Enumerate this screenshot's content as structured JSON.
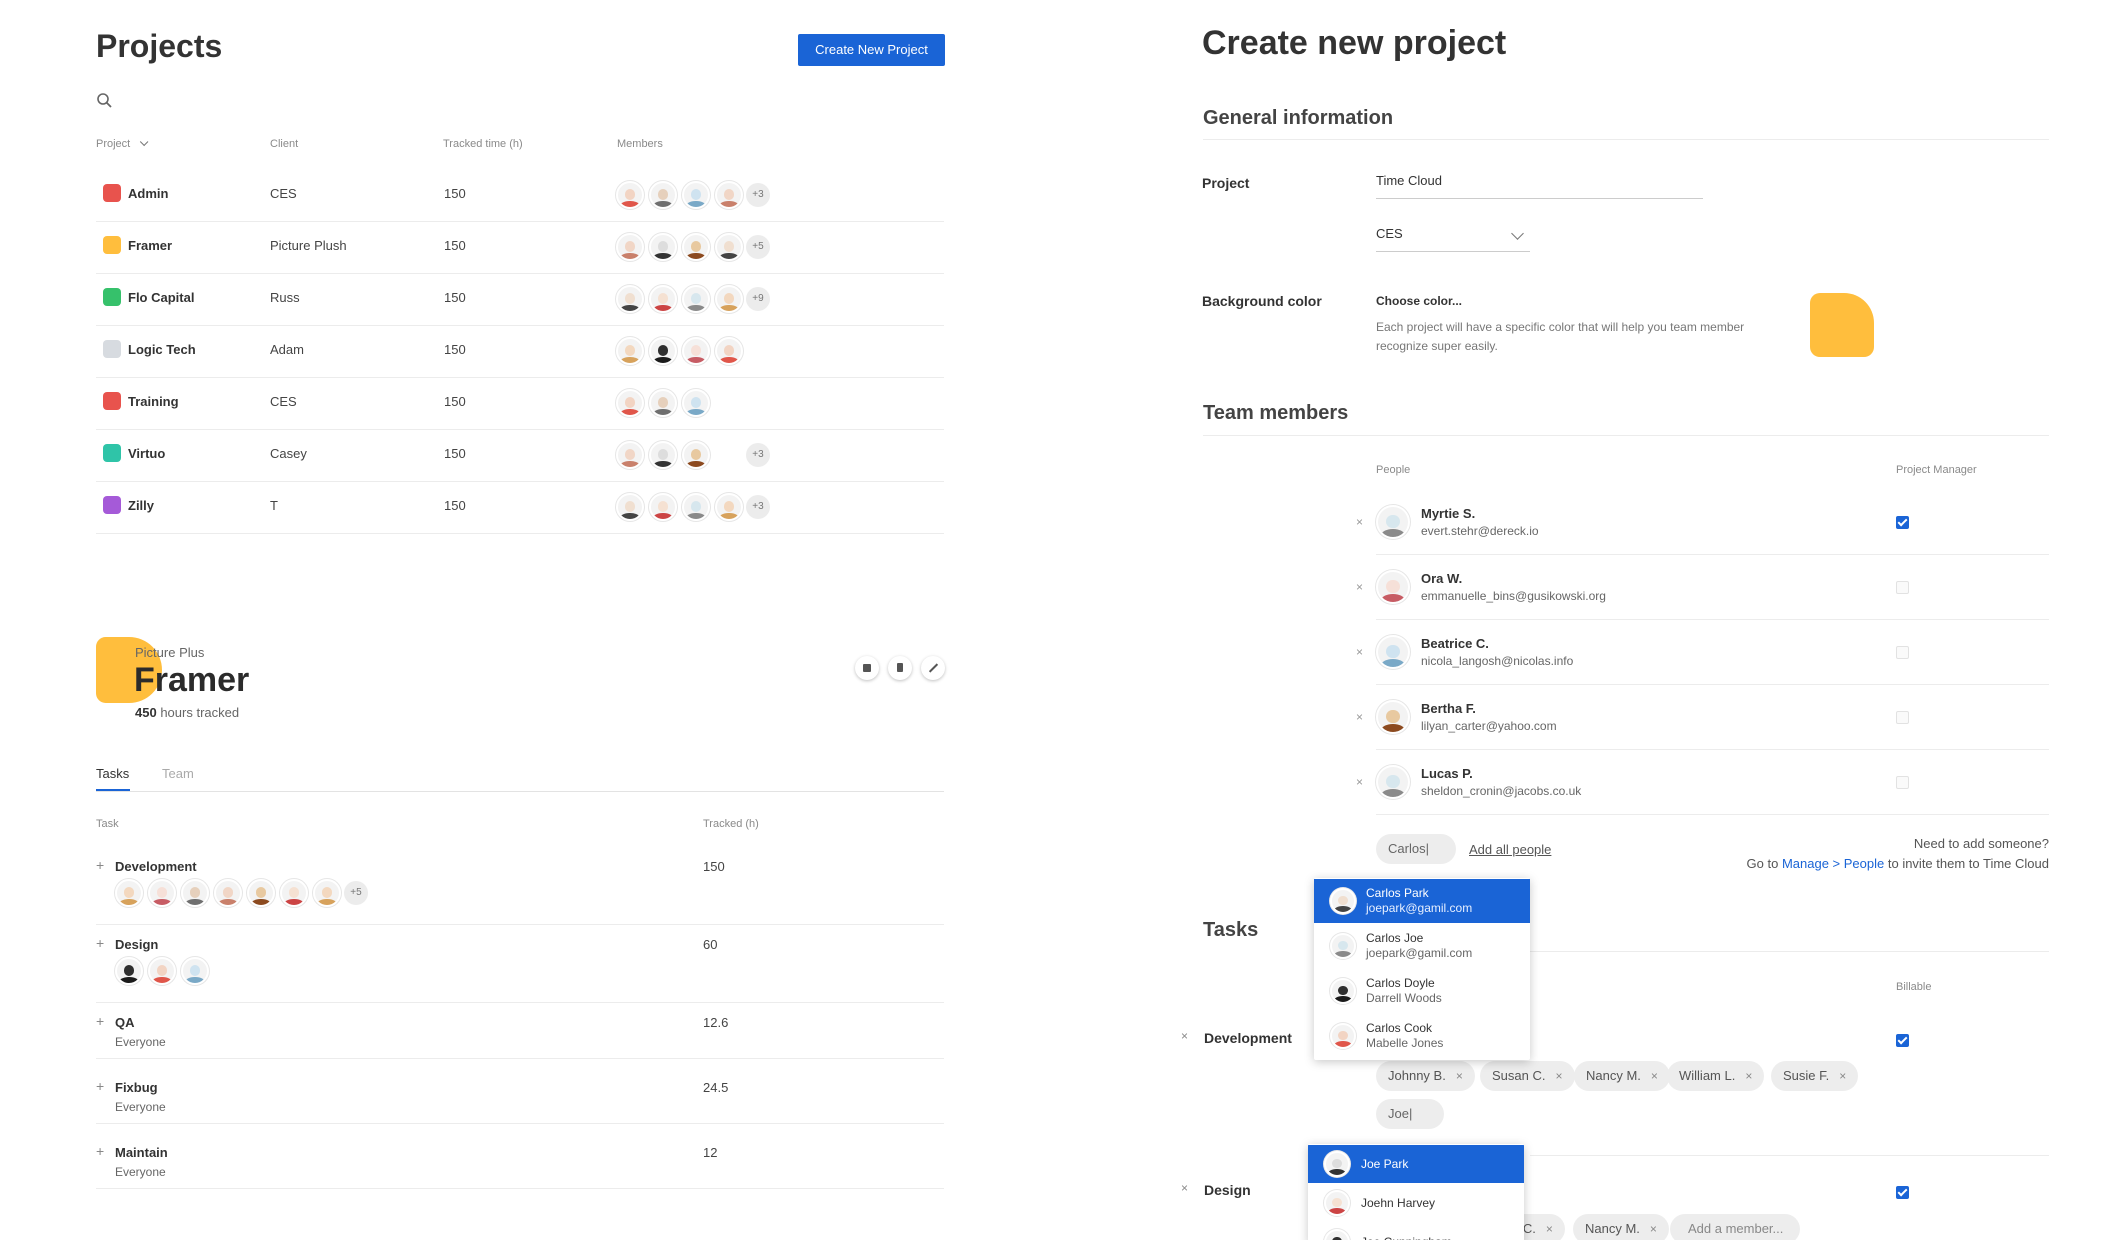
{
  "colors": {
    "accent": "#1a64d6",
    "yellow": "#ffbe3d",
    "red": "#e8534d",
    "green": "#36c16b",
    "grey": "#d7dbe0",
    "teal": "#2fc4a8",
    "purple": "#a55ad8"
  },
  "projects": {
    "title": "Projects",
    "create_button": "Create New Project",
    "search_icon": "search-icon",
    "columns": [
      "Project",
      "Client",
      "Tracked time (h)",
      "Members"
    ],
    "rows": [
      {
        "name": "Admin",
        "client": "CES",
        "tracked": "150",
        "color": "#e8534d",
        "more": "+3"
      },
      {
        "name": "Framer",
        "client": "Picture Plush",
        "tracked": "150",
        "color": "#ffbe3d",
        "more": "+5"
      },
      {
        "name": "Flo Capital",
        "client": "Russ",
        "tracked": "150",
        "color": "#36c16b",
        "more": "+9"
      },
      {
        "name": "Logic Tech",
        "client": "Adam",
        "tracked": "150",
        "color": "#d7dbe0",
        "more": ""
      },
      {
        "name": "Training",
        "client": "CES",
        "tracked": "150",
        "color": "#e8534d",
        "more": ""
      },
      {
        "name": "Virtuo",
        "client": "Casey",
        "tracked": "150",
        "color": "#2fc4a8",
        "more": "+3"
      },
      {
        "name": "Zilly",
        "client": "T",
        "tracked": "150",
        "color": "#a55ad8",
        "more": "+3"
      }
    ]
  },
  "detail": {
    "client": "Picture Plus",
    "name": "Framer",
    "hours_value": "450",
    "hours_label": "hours tracked",
    "tabs": [
      "Tasks",
      "Team"
    ],
    "columns": [
      "Task",
      "Tracked (h)"
    ],
    "tasks": [
      {
        "name": "Development",
        "tracked": "150",
        "sub": "",
        "more": "+5"
      },
      {
        "name": "Design",
        "tracked": "60",
        "sub": "",
        "more": ""
      },
      {
        "name": "QA",
        "tracked": "12.6",
        "sub": "Everyone",
        "more": ""
      },
      {
        "name": "Fixbug",
        "tracked": "24.5",
        "sub": "Everyone",
        "more": ""
      },
      {
        "name": "Maintain",
        "tracked": "12",
        "sub": "Everyone",
        "more": ""
      }
    ]
  },
  "create": {
    "title": "Create new project",
    "general_heading": "General information",
    "project_label": "Project",
    "project_value": "Time Cloud",
    "client_value": "CES",
    "bg_label": "Background color",
    "choose_color": "Choose color...",
    "color_help": "Each project will have a specific color that will help you team member recognize super easily.",
    "team_heading": "Team members",
    "people_col": "People",
    "pm_col": "Project Manager",
    "members": [
      {
        "name": "Myrtie S.",
        "email": "evert.stehr@dereck.io",
        "pm": true
      },
      {
        "name": "Ora W.",
        "email": "emmanuelle_bins@gusikowski.org",
        "pm": false
      },
      {
        "name": "Beatrice C.",
        "email": "nicola_langosh@nicolas.info",
        "pm": false
      },
      {
        "name": "Bertha F.",
        "email": "lilyan_carter@yahoo.com",
        "pm": false
      },
      {
        "name": "Lucas P.",
        "email": "sheldon_cronin@jacobs.co.uk",
        "pm": false
      }
    ],
    "member_search_value": "Carlos|",
    "add_all": "Add all people",
    "need_add": "Need to add someone?",
    "go_to": "Go to",
    "manage_link": "Manage > People",
    "invite_text": "to invite them to Time Cloud",
    "people_dropdown": [
      {
        "name": "Carlos Park",
        "sub": "joepark@gamil.com"
      },
      {
        "name": "Carlos Joe",
        "sub": "joepark@gamil.com"
      },
      {
        "name": "Carlos Doyle",
        "sub": "Darrell Woods"
      },
      {
        "name": "Carlos Cook",
        "sub": "Mabelle Jones"
      }
    ],
    "tasks_heading": "Tasks",
    "billable_col": "Billable",
    "task_rows": [
      {
        "name": "Development"
      },
      {
        "name": "Design"
      }
    ],
    "dev_chips": [
      "Johnny B.",
      "Susan C.",
      "Nancy M.",
      "William L.",
      "Susie F."
    ],
    "dev_search_value": "Joe|",
    "joe_dropdown": [
      "Joe Park",
      "Joehn Harvey",
      "Joe Cunningham"
    ],
    "design_chips": [
      "n C.",
      "Nancy M."
    ],
    "add_member_placeholder": "Add a member..."
  }
}
